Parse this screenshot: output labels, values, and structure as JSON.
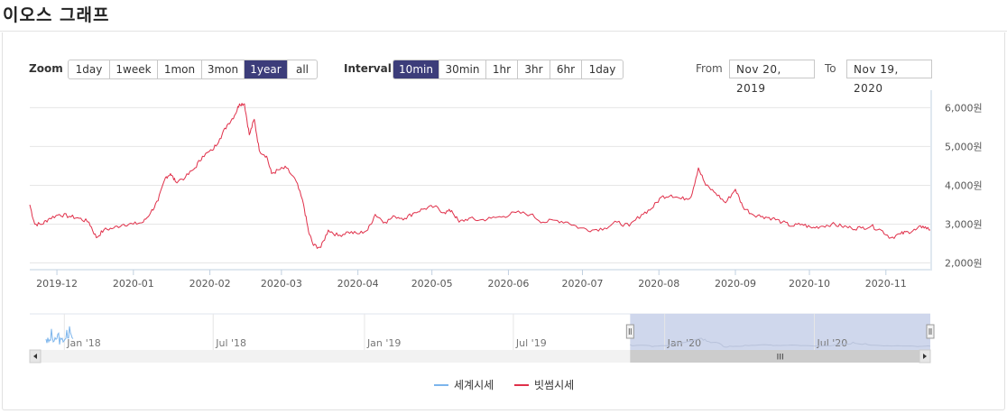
{
  "page": {
    "title": "이오스 그래프"
  },
  "toolbar": {
    "zoom_label": "Zoom",
    "zoom_buttons": [
      "1day",
      "1week",
      "1mon",
      "3mon",
      "1year",
      "all"
    ],
    "zoom_active": "1year",
    "interval_label": "Interval",
    "interval_buttons": [
      "10min",
      "30min",
      "1hr",
      "3hr",
      "6hr",
      "1day"
    ],
    "interval_active": "10min",
    "from_label": "From",
    "from_value": "Nov 20, 2019",
    "to_label": "To",
    "to_value": "Nov 19, 2020"
  },
  "colors": {
    "series_bithumb": "#e0304a",
    "series_world": "#7cb5ec",
    "navigator_mask": "#cad3ea",
    "active_button": "#3c3d7a"
  },
  "chart_data": {
    "type": "line",
    "x_tick_labels": [
      "2019-12",
      "2020-01",
      "2020-02",
      "2020-03",
      "2020-04",
      "2020-05",
      "2020-06",
      "2020-07",
      "2020-08",
      "2020-09",
      "2020-10",
      "2020-11"
    ],
    "y_tick_labels": [
      "6,000원",
      "5,000원",
      "4,000원",
      "3,000원",
      "2,000원"
    ],
    "ylim": [
      1850,
      6450
    ],
    "xlim": [
      "2019-11-20",
      "2020-11-19"
    ],
    "grid": true,
    "legend_position": "bottom-center",
    "series": [
      {
        "name": "빗썸시세",
        "color": "#e0304a",
        "points": [
          [
            "2019-11-20",
            3500
          ],
          [
            "2019-11-22",
            3000
          ],
          [
            "2019-11-25",
            3000
          ],
          [
            "2019-11-28",
            3150
          ],
          [
            "2019-12-02",
            3250
          ],
          [
            "2019-12-06",
            3200
          ],
          [
            "2019-12-10",
            3150
          ],
          [
            "2019-12-14",
            3050
          ],
          [
            "2019-12-17",
            2650
          ],
          [
            "2019-12-20",
            2850
          ],
          [
            "2019-12-24",
            2900
          ],
          [
            "2019-12-28",
            3000
          ],
          [
            "2020-01-01",
            3000
          ],
          [
            "2020-01-05",
            3050
          ],
          [
            "2020-01-08",
            3300
          ],
          [
            "2020-01-11",
            3600
          ],
          [
            "2020-01-14",
            4200
          ],
          [
            "2020-01-16",
            4300
          ],
          [
            "2020-01-18",
            4100
          ],
          [
            "2020-01-22",
            4200
          ],
          [
            "2020-01-26",
            4450
          ],
          [
            "2020-01-29",
            4750
          ],
          [
            "2020-02-02",
            4900
          ],
          [
            "2020-02-05",
            5200
          ],
          [
            "2020-02-08",
            5550
          ],
          [
            "2020-02-11",
            5800
          ],
          [
            "2020-02-13",
            6100
          ],
          [
            "2020-02-15",
            6100
          ],
          [
            "2020-02-17",
            5300
          ],
          [
            "2020-02-19",
            5700
          ],
          [
            "2020-02-21",
            4900
          ],
          [
            "2020-02-24",
            4750
          ],
          [
            "2020-02-26",
            4300
          ],
          [
            "2020-02-29",
            4400
          ],
          [
            "2020-03-03",
            4450
          ],
          [
            "2020-03-07",
            4100
          ],
          [
            "2020-03-10",
            3500
          ],
          [
            "2020-03-12",
            2800
          ],
          [
            "2020-03-14",
            2450
          ],
          [
            "2020-03-17",
            2400
          ],
          [
            "2020-03-20",
            2850
          ],
          [
            "2020-03-24",
            2700
          ],
          [
            "2020-03-28",
            2800
          ],
          [
            "2020-04-01",
            2750
          ],
          [
            "2020-04-05",
            2850
          ],
          [
            "2020-04-08",
            3250
          ],
          [
            "2020-04-12",
            3050
          ],
          [
            "2020-04-16",
            3200
          ],
          [
            "2020-04-20",
            3150
          ],
          [
            "2020-04-24",
            3300
          ],
          [
            "2020-04-28",
            3400
          ],
          [
            "2020-05-02",
            3450
          ],
          [
            "2020-05-06",
            3300
          ],
          [
            "2020-05-09",
            3350
          ],
          [
            "2020-05-12",
            3050
          ],
          [
            "2020-05-16",
            3150
          ],
          [
            "2020-05-20",
            3100
          ],
          [
            "2020-05-25",
            3150
          ],
          [
            "2020-05-30",
            3200
          ],
          [
            "2020-06-04",
            3300
          ],
          [
            "2020-06-10",
            3250
          ],
          [
            "2020-06-15",
            3050
          ],
          [
            "2020-06-20",
            3100
          ],
          [
            "2020-06-25",
            3050
          ],
          [
            "2020-06-30",
            2900
          ],
          [
            "2020-07-05",
            2850
          ],
          [
            "2020-07-10",
            2900
          ],
          [
            "2020-07-15",
            3050
          ],
          [
            "2020-07-20",
            2950
          ],
          [
            "2020-07-25",
            3250
          ],
          [
            "2020-07-29",
            3400
          ],
          [
            "2020-08-02",
            3700
          ],
          [
            "2020-08-06",
            3750
          ],
          [
            "2020-08-10",
            3650
          ],
          [
            "2020-08-14",
            3700
          ],
          [
            "2020-08-17",
            4450
          ],
          [
            "2020-08-20",
            4000
          ],
          [
            "2020-08-24",
            3800
          ],
          [
            "2020-08-28",
            3550
          ],
          [
            "2020-09-01",
            3900
          ],
          [
            "2020-09-04",
            3450
          ],
          [
            "2020-09-08",
            3250
          ],
          [
            "2020-09-12",
            3200
          ],
          [
            "2020-09-16",
            3150
          ],
          [
            "2020-09-20",
            3050
          ],
          [
            "2020-09-24",
            2950
          ],
          [
            "2020-09-28",
            3000
          ],
          [
            "2020-10-02",
            2900
          ],
          [
            "2020-10-06",
            2950
          ],
          [
            "2020-10-10",
            3000
          ],
          [
            "2020-10-14",
            2950
          ],
          [
            "2020-10-18",
            2900
          ],
          [
            "2020-10-22",
            2900
          ],
          [
            "2020-10-26",
            2950
          ],
          [
            "2020-10-30",
            2850
          ],
          [
            "2020-11-03",
            2650
          ],
          [
            "2020-11-07",
            2750
          ],
          [
            "2020-11-10",
            2800
          ],
          [
            "2020-11-13",
            2850
          ],
          [
            "2020-11-16",
            2950
          ],
          [
            "2020-11-19",
            2850
          ]
        ]
      },
      {
        "name": "세계시세",
        "color": "#7cb5ec"
      }
    ],
    "navigator": {
      "x_tick_labels": [
        "Jan '18",
        "Jul '18",
        "Jan '19",
        "Jul '19",
        "Jan '20",
        "Jul '20"
      ],
      "scrollbar_grip": "III"
    }
  }
}
